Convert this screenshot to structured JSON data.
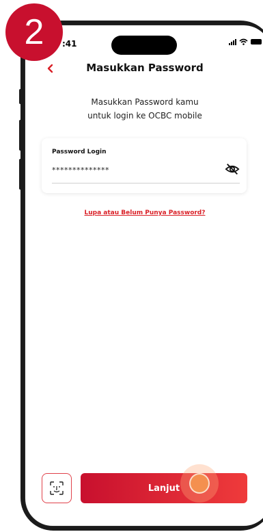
{
  "step": {
    "number": "2"
  },
  "status_bar": {
    "time": ":41"
  },
  "header": {
    "title": "Masukkan Password",
    "back_icon": "chevron-left-icon"
  },
  "intro": {
    "line1": "Masukkan Password kamu",
    "line2": "untuk login ke OCBC mobile"
  },
  "password_field": {
    "label": "Password Login",
    "value": "**************",
    "toggle_icon": "eye-slash-icon"
  },
  "links": {
    "forgot_password": "Lupa atau Belum Punya Password?"
  },
  "actions": {
    "face_id_icon": "face-id-icon",
    "next_label": "Lanjut"
  },
  "colors": {
    "accent": "#d91f26",
    "badge": "#c8102e",
    "tap_indicator": "#f4904f"
  }
}
